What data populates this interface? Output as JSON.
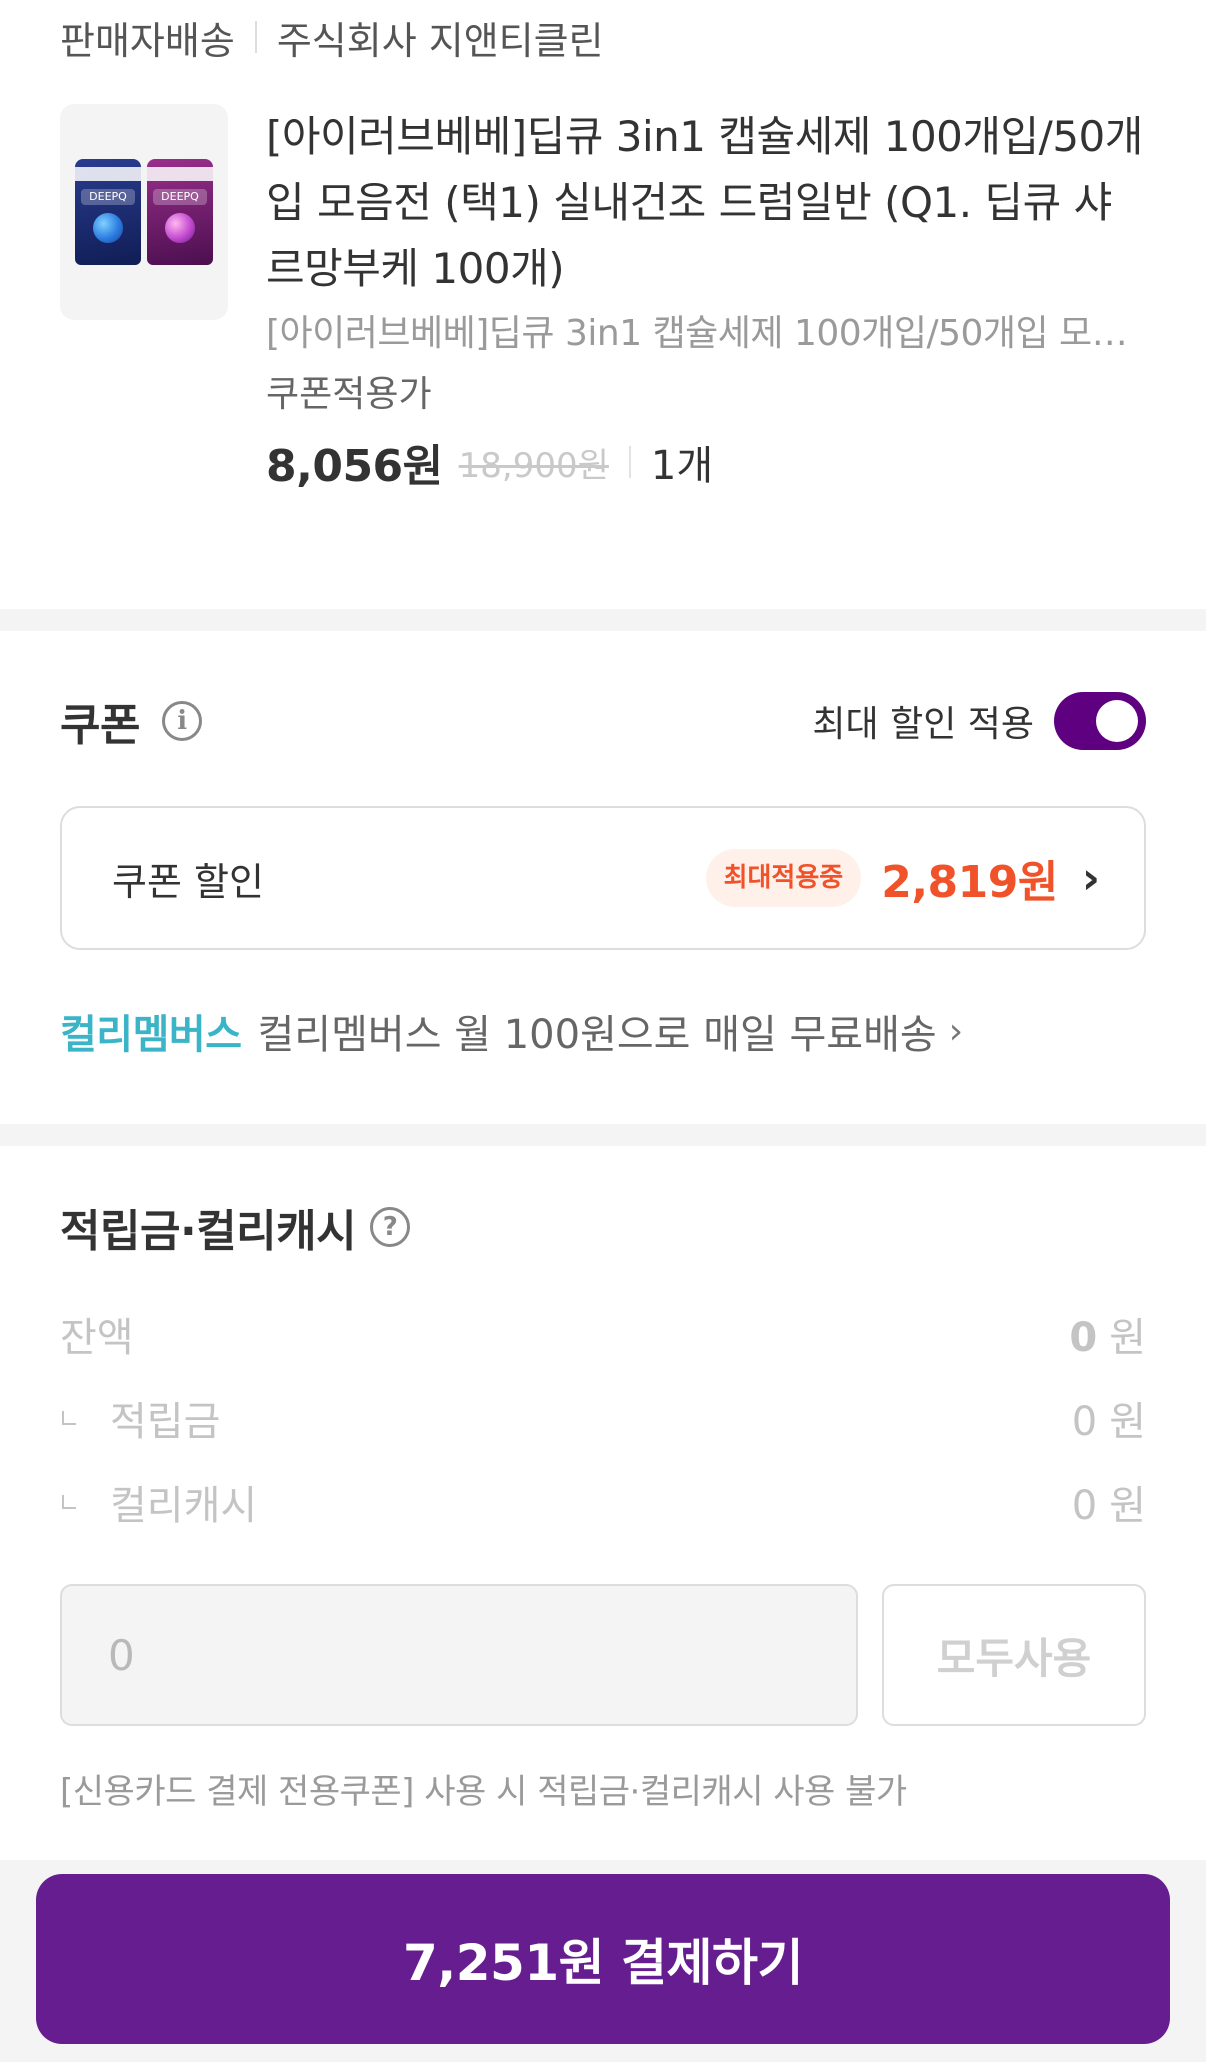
{
  "seller": {
    "type": "판매자배송",
    "company": "주식회사 지앤티클린"
  },
  "product": {
    "image_icon": "detergent-pouch-image",
    "image_text": "DEEPQ",
    "title": "[아이러브베베]딥큐 3in1 캡슐세제 100개입/50개입 모음전 (택1) 실내건조 드럼일반 (Q1. 딥큐 샤르망부케 100개)",
    "option": "[아이러브베베]딥큐 3in1 캡슐세제 100개입/50개입 모음전 (택1) 실내건조 드럼일반 (Q1. 딥큐 샤르망부케 100개)",
    "coupon_label": "쿠폰적용가",
    "price": "8,056원",
    "original_price": "18,900원",
    "quantity": "1개"
  },
  "coupon": {
    "title": "쿠폰",
    "max_label": "최대 할인 적용",
    "max_enabled": true,
    "row_label": "쿠폰 할인",
    "badge": "최대적용중",
    "amount": "2,819원",
    "accent_color": "#f0522a",
    "toggle_color": "#5f0080"
  },
  "membership": {
    "brand": "컬리멤버스",
    "text": "컬리멤버스 월 100원으로 매일 무료배송",
    "brand_color": "#3ab4c6"
  },
  "points": {
    "title": "적립금·컬리캐시",
    "balance_label": "잔액",
    "balance_value": "0",
    "unit": "원",
    "rows": [
      {
        "label": "적립금",
        "value": "0"
      },
      {
        "label": "컬리캐시",
        "value": "0"
      }
    ],
    "input_placeholder": "0",
    "use_all_label": "모두사용",
    "note": "[신용카드 결제 전용쿠폰] 사용 시 적립금·컬리캐시 사용 불가"
  },
  "payment": {
    "button_label": "7,251원 결제하기",
    "button_color": "#661d8f"
  }
}
